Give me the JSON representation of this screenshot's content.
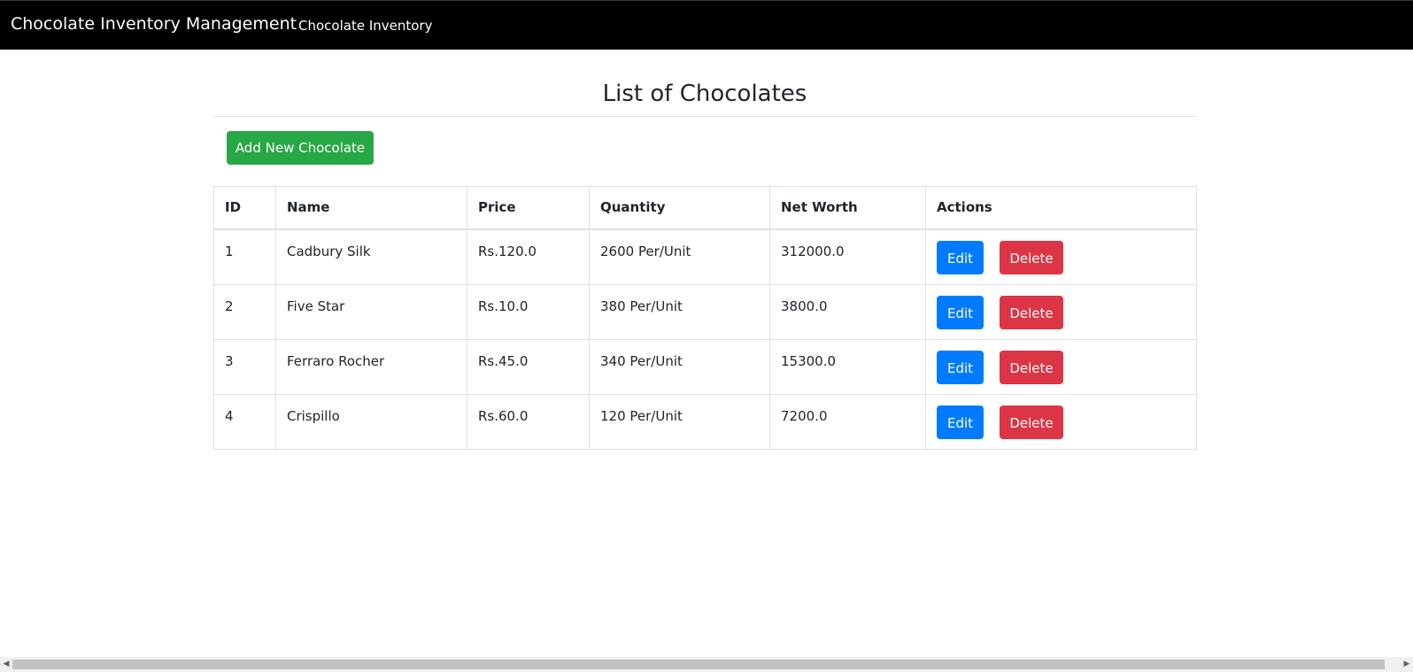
{
  "navbar": {
    "brand": "Chocolate Inventory Management",
    "link": "Chocolate Inventory"
  },
  "main": {
    "title": "List of Chocolates",
    "add_button": "Add New Chocolate"
  },
  "table": {
    "headers": [
      "ID",
      "Name",
      "Price",
      "Quantity",
      "Net Worth",
      "Actions"
    ],
    "rows": [
      {
        "id": "1",
        "name": "Cadbury Silk",
        "price": "Rs.120.0",
        "quantity": "2600 Per/Unit",
        "net_worth": "312000.0",
        "edit": "Edit",
        "delete": "Delete"
      },
      {
        "id": "2",
        "name": "Five Star",
        "price": "Rs.10.0",
        "quantity": "380 Per/Unit",
        "net_worth": "3800.0",
        "edit": "Edit",
        "delete": "Delete"
      },
      {
        "id": "3",
        "name": "Ferraro Rocher",
        "price": "Rs.45.0",
        "quantity": "340 Per/Unit",
        "net_worth": "15300.0",
        "edit": "Edit",
        "delete": "Delete"
      },
      {
        "id": "4",
        "name": "Crispillo",
        "price": "Rs.60.0",
        "quantity": "120 Per/Unit",
        "net_worth": "7200.0",
        "edit": "Edit",
        "delete": "Delete"
      }
    ]
  },
  "colors": {
    "navbar_bg": "#000000",
    "success": "#28a745",
    "primary": "#007bff",
    "danger": "#dc3545"
  },
  "icons": {
    "scroll_left": "chevron-left-icon",
    "scroll_right": "chevron-right-icon"
  }
}
